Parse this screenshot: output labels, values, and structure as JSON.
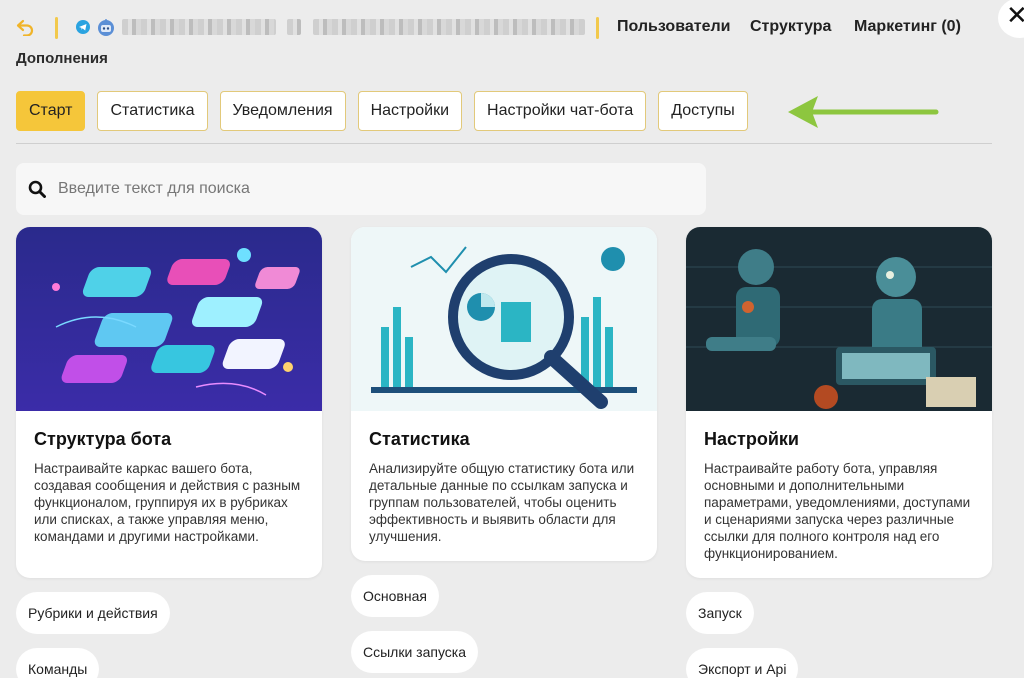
{
  "topbar": {
    "nav_users": "Пользователи",
    "nav_structure": "Структура",
    "nav_marketing": "Маркетинг (0)"
  },
  "page": {
    "title": "Дополнения"
  },
  "tabs": [
    {
      "label": "Старт",
      "active": true
    },
    {
      "label": "Статистика"
    },
    {
      "label": "Уведомления"
    },
    {
      "label": "Настройки"
    },
    {
      "label": "Настройки чат-бота"
    },
    {
      "label": "Доступы"
    }
  ],
  "search": {
    "placeholder": "Введите текст для поиска",
    "value": ""
  },
  "cards": [
    {
      "title": "Структура бота",
      "description": "Настраивайте каркас вашего бота, создавая сообщения и действия с разным функционалом, группируя их в рубриках или списках, а также управляя меню, командами и другими настройками.",
      "links": [
        "Рубрики и действия",
        "Команды"
      ]
    },
    {
      "title": "Статистика",
      "description": "Анализируйте общую статистику бота или детальные данные по ссылкам запуска и группам пользователей, чтобы оценить эффективность и выявить области для улучшения.",
      "links": [
        "Основная",
        "Ссылки запуска"
      ]
    },
    {
      "title": "Настройки",
      "description": "Настраивайте работу бота, управляя основными и дополнительными параметрами, уведомлениями, доступами и сценариями запуска через различные ссылки для полного контроля над его функционированием.",
      "links": [
        "Запуск",
        "Экспорт и Api"
      ]
    }
  ],
  "colors": {
    "accent": "#f5c63a",
    "tab_border": "#e2c97a",
    "arrow": "#8dc63f",
    "background": "#ececec"
  }
}
